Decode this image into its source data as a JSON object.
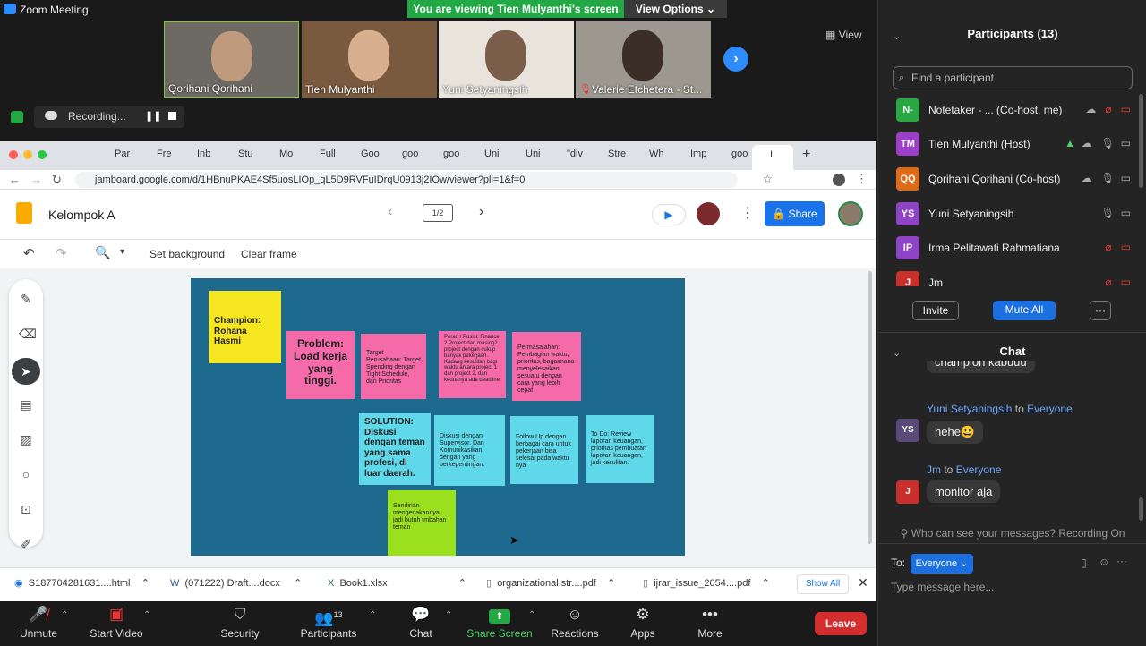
{
  "window": {
    "title": "Zoom Meeting",
    "viewing_banner": "You are viewing Tien Mulyanthi's screen",
    "view_options": "View Options",
    "view_button": "View"
  },
  "videos": [
    {
      "name": "Qorihani Qorihani"
    },
    {
      "name": "Tien Mulyanthi"
    },
    {
      "name": "Yuni Setyaningsih"
    },
    {
      "name": "Valerie Etchetera - St..."
    }
  ],
  "recording": {
    "label": "Recording..."
  },
  "browser": {
    "tabs": [
      "Par",
      "Fre",
      "Inb",
      "Stu",
      "Mo",
      "Full",
      "Goo",
      "goo",
      "goo",
      "Uni",
      "Uni",
      "\"div",
      "Stre",
      "Wh",
      "Imp",
      "goo",
      "I"
    ],
    "url": "jamboard.google.com/d/1HBnuPKAE4Sf5uosLIOp_qL5D9RVFuIDrqU0913j2IOw/viewer?pli=1&f=0"
  },
  "jamboard": {
    "title": "Kelompok A",
    "frame": "1/2",
    "share": "Share",
    "set_background": "Set background",
    "clear_frame": "Clear frame"
  },
  "notes": [
    {
      "text": "Champion: Rohana Hasmi",
      "color": "#f5e620"
    },
    {
      "text": "Problem: Load kerja yang tinggi.",
      "color": "#f56aa8"
    },
    {
      "text": "Target Perusahaan: Target Spending dengan Tight Schedule, dan Prioritas",
      "color": "#f56aa8"
    },
    {
      "text": "Peran / Posisi: Finance 2 Project dan masing2 project dengan cukup banyak pekerjaan. Kadang kesulitan bagi waktu antara project 1 dan project 2, dan keduanya ada deadline",
      "color": "#f56aa8"
    },
    {
      "text": "Permasalahan: Pembagian waktu, prioritas, bagaimana menyelesaikan sesuatu dengan cara yang lebih cepat",
      "color": "#f56aa8"
    },
    {
      "text": "SOLUTION: Diskusi dengan teman yang sama profesi, di luar daerah.",
      "color": "#5fd8ea"
    },
    {
      "text": "Diskusi dengan Supervisor. Dan Komunikasikan dengan yang berkepentingan.",
      "color": "#5fd8ea"
    },
    {
      "text": "Follow Up dengan berbagai cara untuk pekerjaan bisa selesai pada waktu nya",
      "color": "#5fd8ea"
    },
    {
      "text": "To Do: Review laporan keuangan, prioritas pembuatan laporan keuangan, jadi kesulitan.",
      "color": "#5fd8ea"
    },
    {
      "text": "Sendirian mengerjakannya, jadi butuh tmbahan teman",
      "color": "#9be01c"
    }
  ],
  "downloads": [
    "S187704281631....html",
    "(071222) Draft....docx",
    "Book1.xlsx",
    "organizational str....pdf",
    "ijrar_issue_2054....pdf"
  ],
  "downloads_show_all": "Show All",
  "toolbar": {
    "unmute": "Unmute",
    "start_video": "Start Video",
    "security": "Security",
    "participants": "Participants",
    "participants_count": "13",
    "chat": "Chat",
    "share_screen": "Share Screen",
    "reactions": "Reactions",
    "apps": "Apps",
    "more": "More",
    "leave": "Leave"
  },
  "participants_panel": {
    "title": "Participants (13)",
    "search_placeholder": "Find a participant",
    "list": [
      {
        "initials": "N-",
        "name": "Notetaker - ... (Co-host, me)",
        "color": "#27a843"
      },
      {
        "initials": "TM",
        "name": "Tien Mulyanthi (Host)",
        "color": "#9c3fc9"
      },
      {
        "initials": "QQ",
        "name": "Qorihani Qorihani (Co-host)",
        "color": "#e06a17"
      },
      {
        "initials": "YS",
        "name": "Yuni Setyaningsih",
        "color": "#8e44c4"
      },
      {
        "initials": "IP",
        "name": "Irma Pelitawati Rahmatiana",
        "color": "#8e44c4"
      },
      {
        "initials": "J",
        "name": "Jm",
        "color": "#c9302c"
      }
    ],
    "invite": "Invite",
    "mute_all": "Mute All",
    "more": "···"
  },
  "chat": {
    "title": "Chat",
    "partial": "champion kabuuu",
    "messages": [
      {
        "sender": "Yuni Setyaningsih",
        "to": "to",
        "recipient": "Everyone",
        "initials": "YS",
        "text": "hehe😃"
      },
      {
        "sender": "Jm",
        "to": "to",
        "recipient": "Everyone",
        "initials": "J",
        "text": "monitor aja"
      }
    ],
    "who_can_see": "Who can see your messages? Recording On",
    "to_label": "To:",
    "recipient": "Everyone",
    "placeholder": "Type message here..."
  }
}
